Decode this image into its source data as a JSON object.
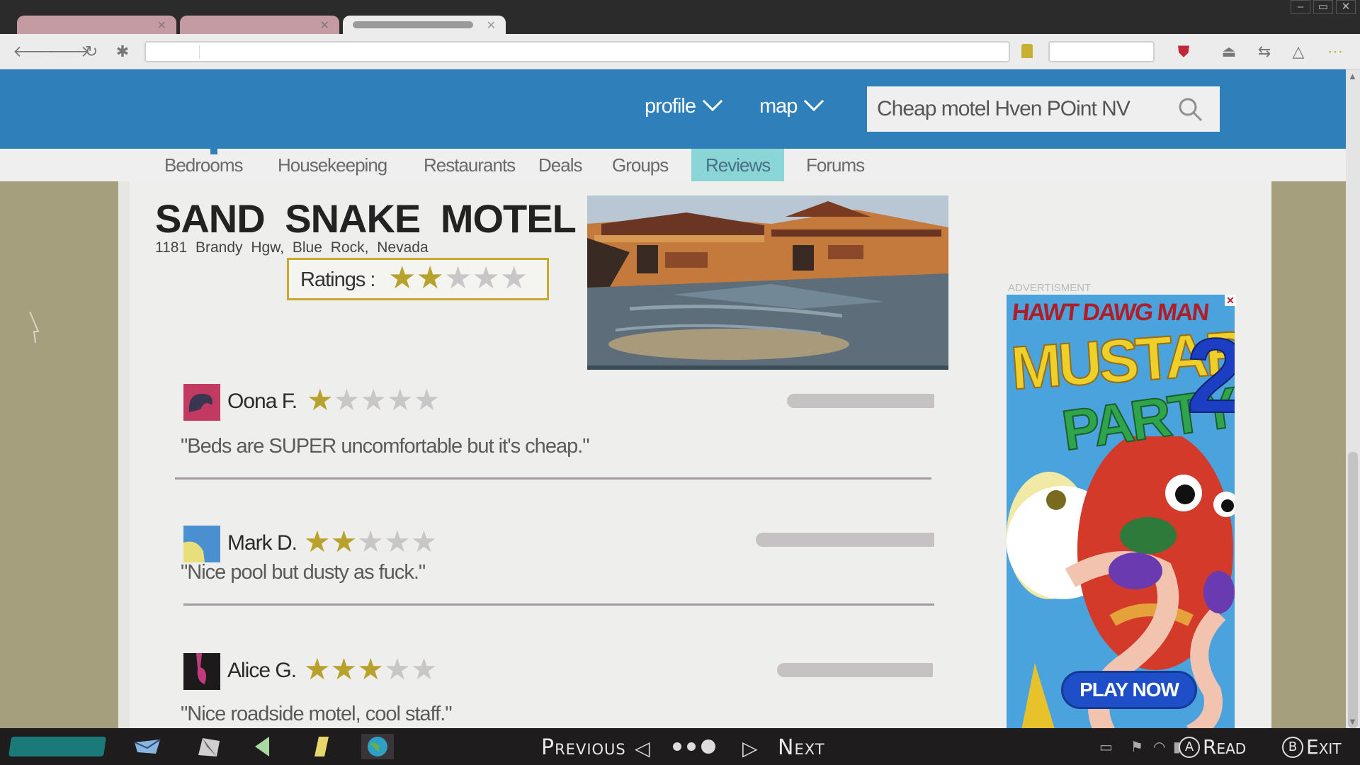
{
  "browser": {
    "tabs": [
      {
        "label": ""
      },
      {
        "label": ""
      },
      {
        "label": ""
      }
    ],
    "url": ""
  },
  "site": {
    "nav": {
      "profile_label": "profile",
      "map_label": "map"
    },
    "search": {
      "value": "Cheap motel Hven POint NV"
    },
    "subnav": [
      "Bedrooms",
      "Housekeeping",
      "Restaurants",
      "Deals",
      "Groups",
      "Reviews",
      "Forums"
    ],
    "active_subnav": "Reviews"
  },
  "motel": {
    "name": "SAND SNAKE MOTEL",
    "address": "1181 Brandy Hgw, Blue Rock, Nevada",
    "ratings_label": "Ratings :",
    "rating": 2,
    "rating_max": 5
  },
  "reviews": [
    {
      "name": "Oona F.",
      "stars": 1,
      "text": "\"Beds are SUPER uncomfortable but it's cheap.\"",
      "avatar_colors": [
        "#c23a62",
        "#3a3550"
      ]
    },
    {
      "name": "Mark D.",
      "stars": 2,
      "text": "\"Nice pool but dusty as fuck.\"",
      "avatar_colors": [
        "#4a8fd0",
        "#e8df7a"
      ]
    },
    {
      "name": "Alice G.",
      "stars": 3,
      "text": "\"Nice roadside motel, cool staff.\"",
      "avatar_colors": [
        "#1d1a1c",
        "#c43a7a"
      ]
    }
  ],
  "ad": {
    "label": "ADVERTISMENT",
    "subtitle": "HAWT DAWG MAN",
    "title_line1": "MUSTARD",
    "title_line2": "PARTY",
    "number": "2",
    "cta": "PLAY NOW",
    "close_glyph": "✕"
  },
  "console": {
    "previous": "Previous",
    "next": "Next",
    "read_button": "A",
    "read_label": "Read",
    "exit_button": "B",
    "exit_label": "Exit"
  },
  "colors": {
    "header_blue": "#2e7fba",
    "active_tab": "#8ad6d6",
    "star_on": "#b8a12c",
    "star_off": "#c9c6c8",
    "page_bg": "#a69f7e"
  }
}
